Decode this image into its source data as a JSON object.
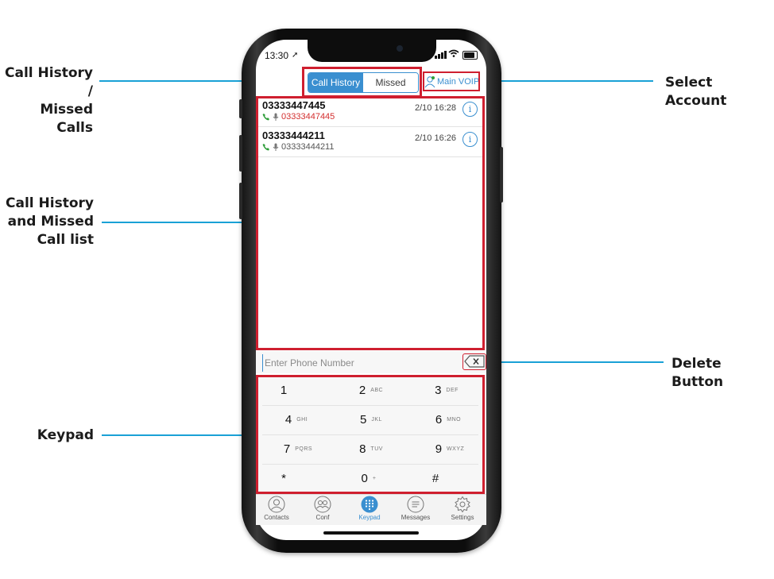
{
  "annotations": {
    "call_history_missed_calls": [
      "Call History /",
      "Missed Calls"
    ],
    "call_list": [
      "Call History",
      "and Missed",
      "Call list"
    ],
    "keypad": "Keypad",
    "select_account": "Select Account",
    "delete_button": "Delete Button"
  },
  "status_bar": {
    "time": "13:30"
  },
  "segmented": {
    "history_label": "Call History",
    "missed_label": "Missed"
  },
  "account": {
    "label": "Main VOIP"
  },
  "calls": [
    {
      "number": "03333447445",
      "sub_number": "03333447445",
      "date": "2/10 16:28",
      "sub_color": "#d32f2f"
    },
    {
      "number": "03333444211",
      "sub_number": "03333444211",
      "date": "2/10 16:26",
      "sub_color": "#555555"
    }
  ],
  "input": {
    "placeholder": "Enter Phone Number"
  },
  "keypad": [
    {
      "digit": "1",
      "letters": ""
    },
    {
      "digit": "2",
      "letters": "ABC"
    },
    {
      "digit": "3",
      "letters": "DEF"
    },
    {
      "digit": "4",
      "letters": "GHI"
    },
    {
      "digit": "5",
      "letters": "JKL"
    },
    {
      "digit": "6",
      "letters": "MNO"
    },
    {
      "digit": "7",
      "letters": "PQRS"
    },
    {
      "digit": "8",
      "letters": "TUV"
    },
    {
      "digit": "9",
      "letters": "WXYZ"
    },
    {
      "digit": "*",
      "letters": ""
    },
    {
      "digit": "0",
      "letters": "+"
    },
    {
      "digit": "#",
      "letters": ""
    }
  ],
  "tabs": [
    {
      "label": "Contacts",
      "icon": "contacts-icon"
    },
    {
      "label": "Conf",
      "icon": "conference-icon"
    },
    {
      "label": "Keypad",
      "icon": "keypad-icon",
      "active": true
    },
    {
      "label": "Messages",
      "icon": "messages-icon"
    },
    {
      "label": "Settings",
      "icon": "settings-icon"
    }
  ],
  "colors": {
    "accent": "#3a8fd0",
    "highlight": "#cf1f2f",
    "leader_line": "#1aa1d6",
    "missed_call": "#d32f2f",
    "call_icon": "#2e9e3a"
  }
}
